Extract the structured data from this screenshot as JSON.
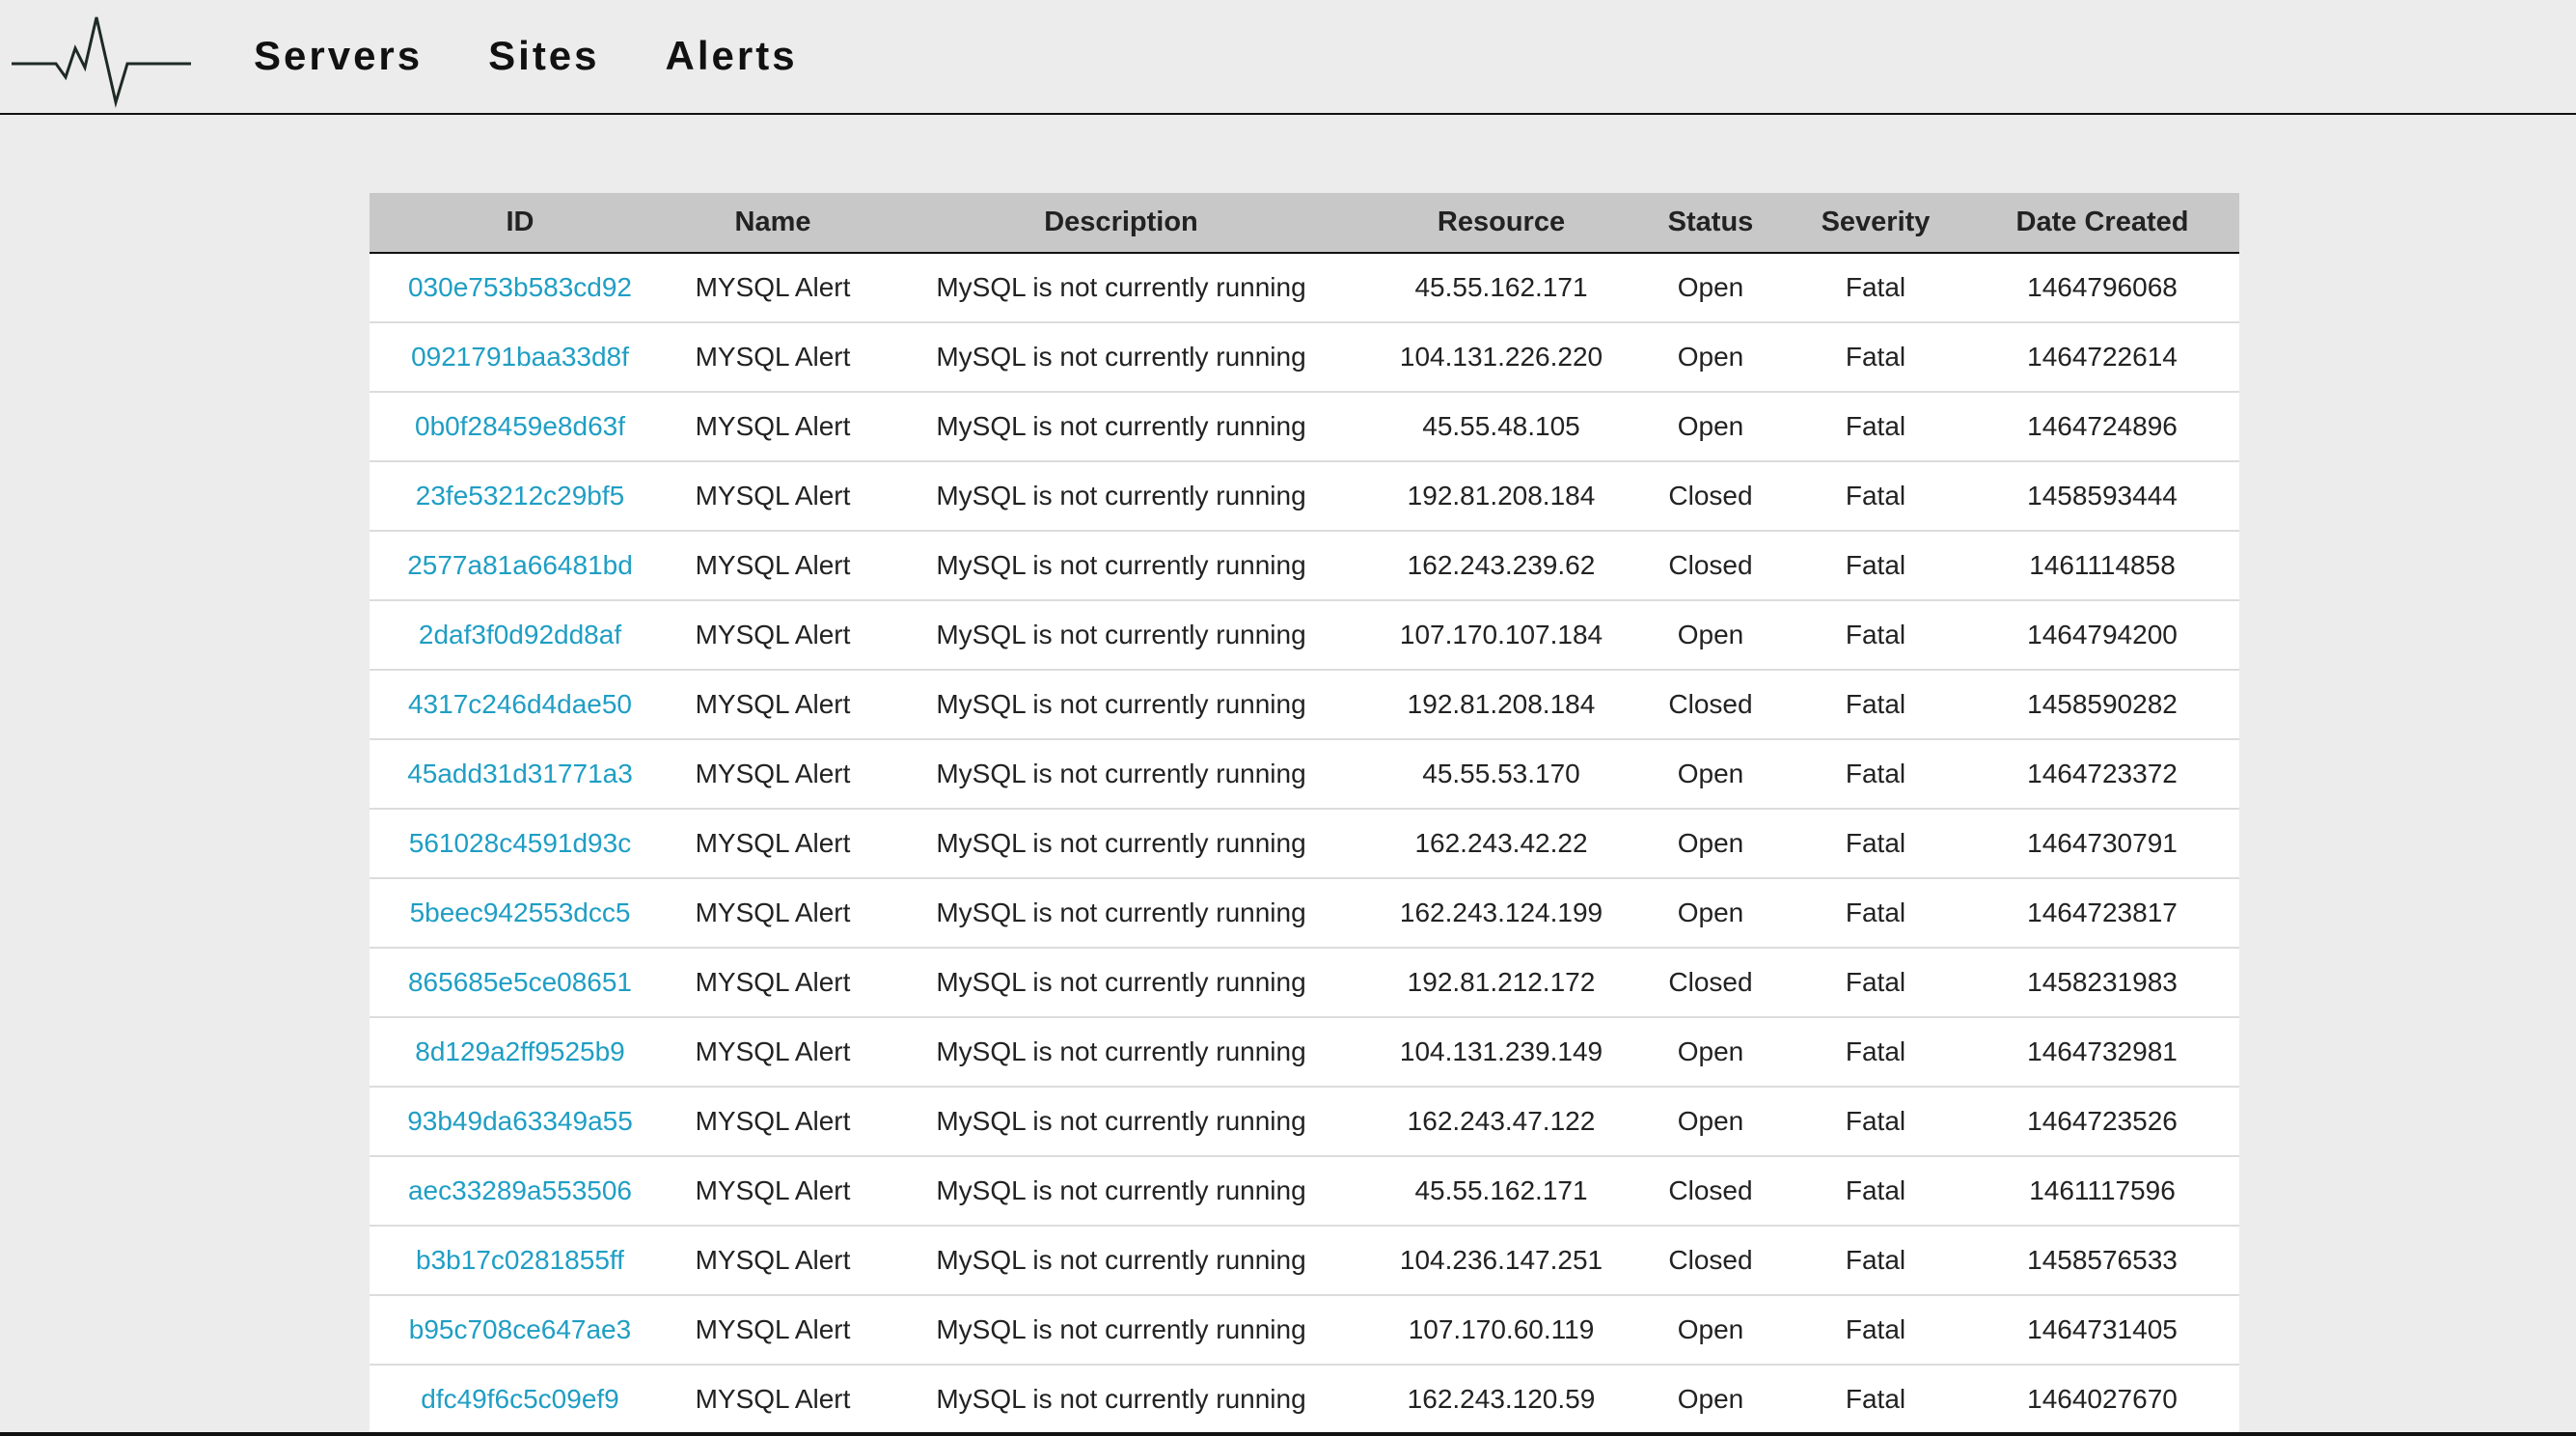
{
  "nav": {
    "items": [
      "Servers",
      "Sites",
      "Alerts"
    ]
  },
  "colors": {
    "link": "#1f9ec4",
    "header_bg": "#c8c8c8",
    "page_bg": "#ececec"
  },
  "table": {
    "columns": [
      "ID",
      "Name",
      "Description",
      "Resource",
      "Status",
      "Severity",
      "Date Created"
    ],
    "rows": [
      {
        "id": "030e753b583cd92",
        "name": "MYSQL Alert",
        "description": "MySQL is not currently running",
        "resource": "45.55.162.171",
        "status": "Open",
        "severity": "Fatal",
        "date_created": "1464796068"
      },
      {
        "id": "0921791baa33d8f",
        "name": "MYSQL Alert",
        "description": "MySQL is not currently running",
        "resource": "104.131.226.220",
        "status": "Open",
        "severity": "Fatal",
        "date_created": "1464722614"
      },
      {
        "id": "0b0f28459e8d63f",
        "name": "MYSQL Alert",
        "description": "MySQL is not currently running",
        "resource": "45.55.48.105",
        "status": "Open",
        "severity": "Fatal",
        "date_created": "1464724896"
      },
      {
        "id": "23fe53212c29bf5",
        "name": "MYSQL Alert",
        "description": "MySQL is not currently running",
        "resource": "192.81.208.184",
        "status": "Closed",
        "severity": "Fatal",
        "date_created": "1458593444"
      },
      {
        "id": "2577a81a66481bd",
        "name": "MYSQL Alert",
        "description": "MySQL is not currently running",
        "resource": "162.243.239.62",
        "status": "Closed",
        "severity": "Fatal",
        "date_created": "1461114858"
      },
      {
        "id": "2daf3f0d92dd8af",
        "name": "MYSQL Alert",
        "description": "MySQL is not currently running",
        "resource": "107.170.107.184",
        "status": "Open",
        "severity": "Fatal",
        "date_created": "1464794200"
      },
      {
        "id": "4317c246d4dae50",
        "name": "MYSQL Alert",
        "description": "MySQL is not currently running",
        "resource": "192.81.208.184",
        "status": "Closed",
        "severity": "Fatal",
        "date_created": "1458590282"
      },
      {
        "id": "45add31d31771a3",
        "name": "MYSQL Alert",
        "description": "MySQL is not currently running",
        "resource": "45.55.53.170",
        "status": "Open",
        "severity": "Fatal",
        "date_created": "1464723372"
      },
      {
        "id": "561028c4591d93c",
        "name": "MYSQL Alert",
        "description": "MySQL is not currently running",
        "resource": "162.243.42.22",
        "status": "Open",
        "severity": "Fatal",
        "date_created": "1464730791"
      },
      {
        "id": "5beec942553dcc5",
        "name": "MYSQL Alert",
        "description": "MySQL is not currently running",
        "resource": "162.243.124.199",
        "status": "Open",
        "severity": "Fatal",
        "date_created": "1464723817"
      },
      {
        "id": "865685e5ce08651",
        "name": "MYSQL Alert",
        "description": "MySQL is not currently running",
        "resource": "192.81.212.172",
        "status": "Closed",
        "severity": "Fatal",
        "date_created": "1458231983"
      },
      {
        "id": "8d129a2ff9525b9",
        "name": "MYSQL Alert",
        "description": "MySQL is not currently running",
        "resource": "104.131.239.149",
        "status": "Open",
        "severity": "Fatal",
        "date_created": "1464732981"
      },
      {
        "id": "93b49da63349a55",
        "name": "MYSQL Alert",
        "description": "MySQL is not currently running",
        "resource": "162.243.47.122",
        "status": "Open",
        "severity": "Fatal",
        "date_created": "1464723526"
      },
      {
        "id": "aec33289a553506",
        "name": "MYSQL Alert",
        "description": "MySQL is not currently running",
        "resource": "45.55.162.171",
        "status": "Closed",
        "severity": "Fatal",
        "date_created": "1461117596"
      },
      {
        "id": "b3b17c0281855ff",
        "name": "MYSQL Alert",
        "description": "MySQL is not currently running",
        "resource": "104.236.147.251",
        "status": "Closed",
        "severity": "Fatal",
        "date_created": "1458576533"
      },
      {
        "id": "b95c708ce647ae3",
        "name": "MYSQL Alert",
        "description": "MySQL is not currently running",
        "resource": "107.170.60.119",
        "status": "Open",
        "severity": "Fatal",
        "date_created": "1464731405"
      },
      {
        "id": "dfc49f6c5c09ef9",
        "name": "MYSQL Alert",
        "description": "MySQL is not currently running",
        "resource": "162.243.120.59",
        "status": "Open",
        "severity": "Fatal",
        "date_created": "1464027670"
      }
    ]
  }
}
